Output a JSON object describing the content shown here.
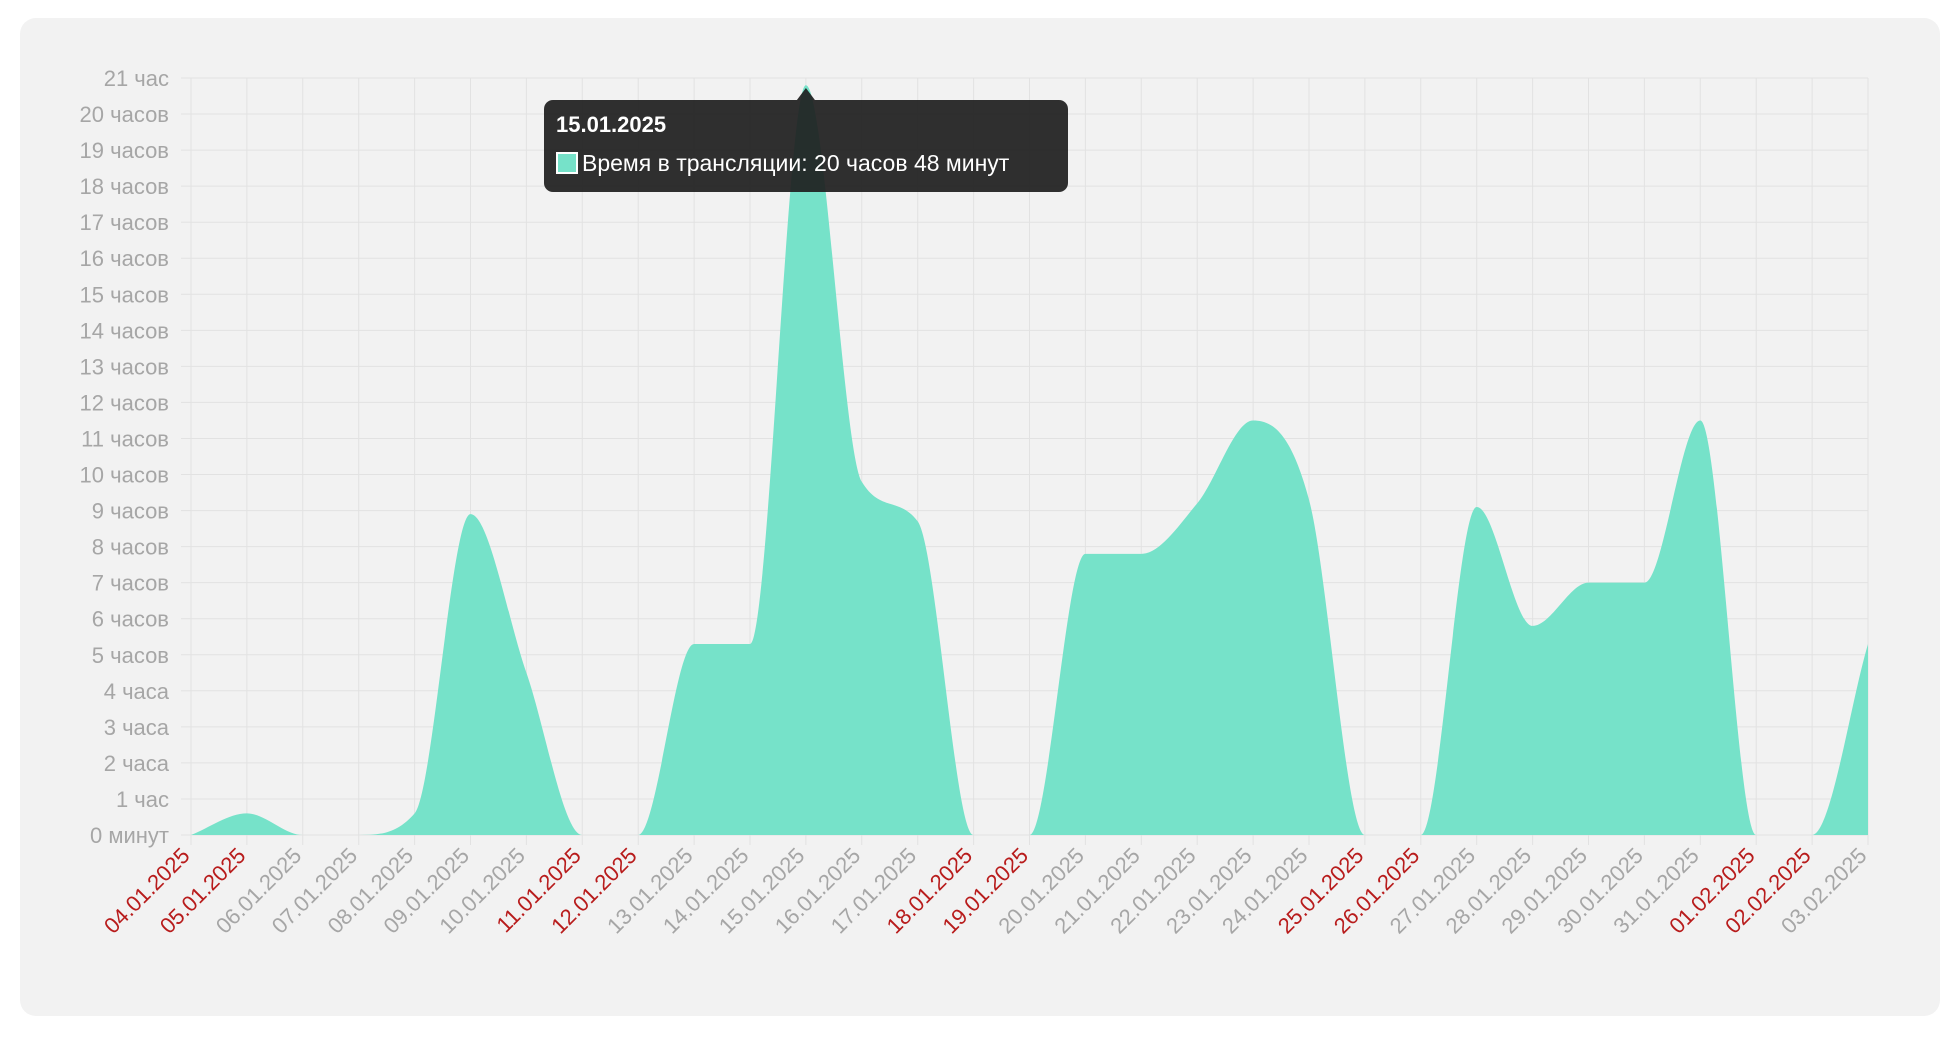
{
  "chart_data": {
    "type": "area",
    "x": [
      "04.01.2025",
      "05.01.2025",
      "06.01.2025",
      "07.01.2025",
      "08.01.2025",
      "09.01.2025",
      "10.01.2025",
      "11.01.2025",
      "12.01.2025",
      "13.01.2025",
      "14.01.2025",
      "15.01.2025",
      "16.01.2025",
      "17.01.2025",
      "18.01.2025",
      "19.01.2025",
      "20.01.2025",
      "21.01.2025",
      "22.01.2025",
      "23.01.2025",
      "24.01.2025",
      "25.01.2025",
      "26.01.2025",
      "27.01.2025",
      "28.01.2025",
      "29.01.2025",
      "30.01.2025",
      "31.01.2025",
      "01.02.2025",
      "02.02.2025",
      "03.02.2025"
    ],
    "weekend": [
      true,
      true,
      false,
      false,
      false,
      false,
      false,
      true,
      true,
      false,
      false,
      false,
      false,
      false,
      true,
      true,
      false,
      false,
      false,
      false,
      false,
      true,
      true,
      false,
      false,
      false,
      false,
      false,
      true,
      true,
      false
    ],
    "series": [
      {
        "name": "Время в трансляции",
        "values_hours": [
          0,
          0.6,
          0,
          0,
          0.6,
          8.9,
          4.5,
          0,
          0,
          5.3,
          5.3,
          20.8,
          9.8,
          8.7,
          0,
          0,
          7.8,
          7.8,
          9.2,
          11.5,
          9.3,
          0,
          0,
          9.1,
          5.8,
          7.0,
          7.0,
          11.5,
          0,
          0,
          5.3
        ]
      }
    ],
    "y_ticks": [
      "0 минут",
      "1 час",
      "2 часа",
      "3 часа",
      "4 часа",
      "5 часов",
      "6 часов",
      "7 часов",
      "8 часов",
      "9 часов",
      "10 часов",
      "11 часов",
      "12 часов",
      "13 часов",
      "14 часов",
      "15 часов",
      "16 часов",
      "17 часов",
      "18 часов",
      "19 часов",
      "20 часов",
      "21 час"
    ],
    "ylim": [
      0,
      21
    ],
    "grid": true,
    "colors": {
      "area": "#76e2c9",
      "grid": "#e2e2e2",
      "tick": "#a6a6a6",
      "weekend_tick": "#b81c1c"
    }
  },
  "tooltip": {
    "title": "15.01.2025",
    "label": "Время в трансляции: 20 часов 48 минут"
  }
}
